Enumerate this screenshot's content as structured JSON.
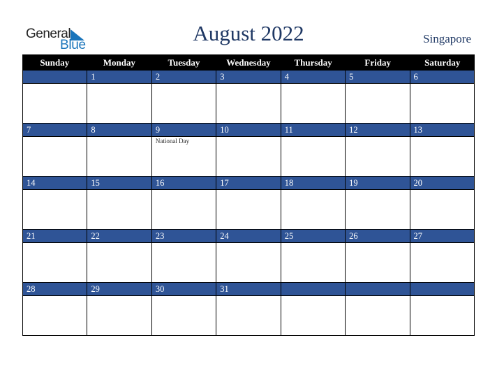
{
  "brand": {
    "line1": "General",
    "line2": "Blue"
  },
  "title": "August 2022",
  "country": "Singapore",
  "weekdays": [
    "Sunday",
    "Monday",
    "Tuesday",
    "Wednesday",
    "Thursday",
    "Friday",
    "Saturday"
  ],
  "weeks": [
    [
      {
        "day": "",
        "event": ""
      },
      {
        "day": "1",
        "event": ""
      },
      {
        "day": "2",
        "event": ""
      },
      {
        "day": "3",
        "event": ""
      },
      {
        "day": "4",
        "event": ""
      },
      {
        "day": "5",
        "event": ""
      },
      {
        "day": "6",
        "event": ""
      }
    ],
    [
      {
        "day": "7",
        "event": ""
      },
      {
        "day": "8",
        "event": ""
      },
      {
        "day": "9",
        "event": "National Day"
      },
      {
        "day": "10",
        "event": ""
      },
      {
        "day": "11",
        "event": ""
      },
      {
        "day": "12",
        "event": ""
      },
      {
        "day": "13",
        "event": ""
      }
    ],
    [
      {
        "day": "14",
        "event": ""
      },
      {
        "day": "15",
        "event": ""
      },
      {
        "day": "16",
        "event": ""
      },
      {
        "day": "17",
        "event": ""
      },
      {
        "day": "18",
        "event": ""
      },
      {
        "day": "19",
        "event": ""
      },
      {
        "day": "20",
        "event": ""
      }
    ],
    [
      {
        "day": "21",
        "event": ""
      },
      {
        "day": "22",
        "event": ""
      },
      {
        "day": "23",
        "event": ""
      },
      {
        "day": "24",
        "event": ""
      },
      {
        "day": "25",
        "event": ""
      },
      {
        "day": "26",
        "event": ""
      },
      {
        "day": "27",
        "event": ""
      }
    ],
    [
      {
        "day": "28",
        "event": ""
      },
      {
        "day": "29",
        "event": ""
      },
      {
        "day": "30",
        "event": ""
      },
      {
        "day": "31",
        "event": ""
      },
      {
        "day": "",
        "event": ""
      },
      {
        "day": "",
        "event": ""
      },
      {
        "day": "",
        "event": ""
      }
    ]
  ],
  "colors": {
    "band": "#2f5496",
    "header": "#000000",
    "title": "#1f3864",
    "brand_blue": "#1a75bb"
  }
}
